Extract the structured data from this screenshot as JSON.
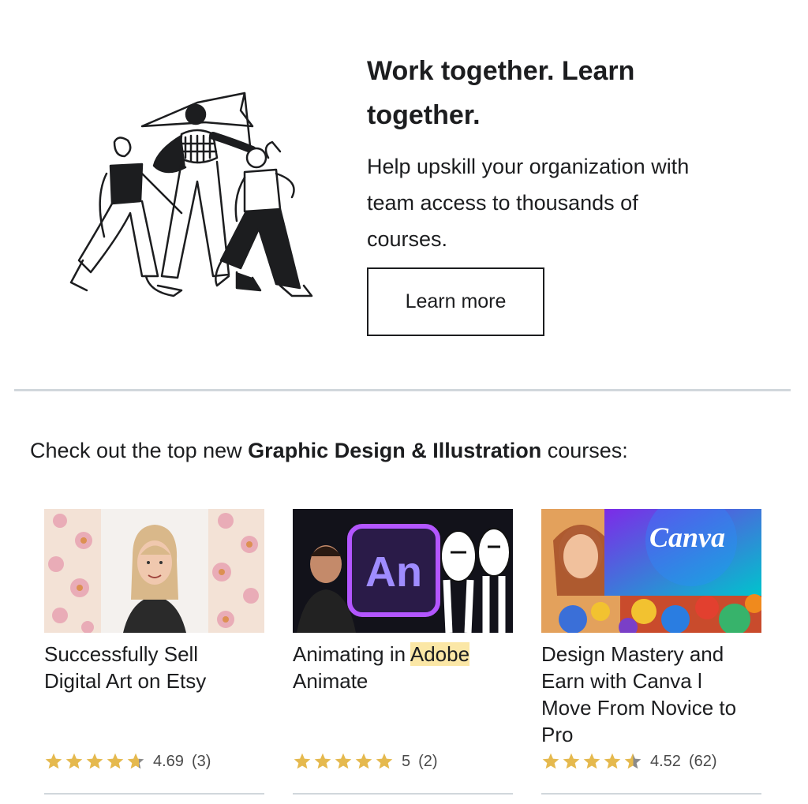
{
  "hero": {
    "title_line1": "Work together. Learn",
    "title_line2": "together.",
    "body_line1": "Help upskill your organization with",
    "body_line2": "team access to thousands of",
    "body_line3": "courses.",
    "button_label": "Learn more"
  },
  "section": {
    "prefix": "Check out the top new ",
    "category": "Graphic Design & Illustration",
    "suffix": " courses:"
  },
  "courses": [
    {
      "title_line1": "Successfully Sell",
      "title_line2": "Digital Art on Etsy",
      "rating_value": "4.69",
      "rating_count": "(3)",
      "stars": 4.69
    },
    {
      "title_prefix": "Animating in ",
      "title_highlight": "Adobe",
      "title_line2": "Animate",
      "thumb_text": "An",
      "rating_value": "5",
      "rating_count": "(2)",
      "stars": 5
    },
    {
      "title_line1": "Design Mastery and",
      "title_line2": "Earn with Canva l",
      "title_line3": "Move From Novice to",
      "title_line4": "Pro",
      "thumb_text": "Canva",
      "rating_value": "4.52",
      "rating_count": "(62)",
      "stars": 4.52
    }
  ],
  "colors": {
    "star": "#e5b94e",
    "star_empty": "#8a8a8a",
    "highlight": "#fbe7a6",
    "divider": "#d1d7dc"
  }
}
